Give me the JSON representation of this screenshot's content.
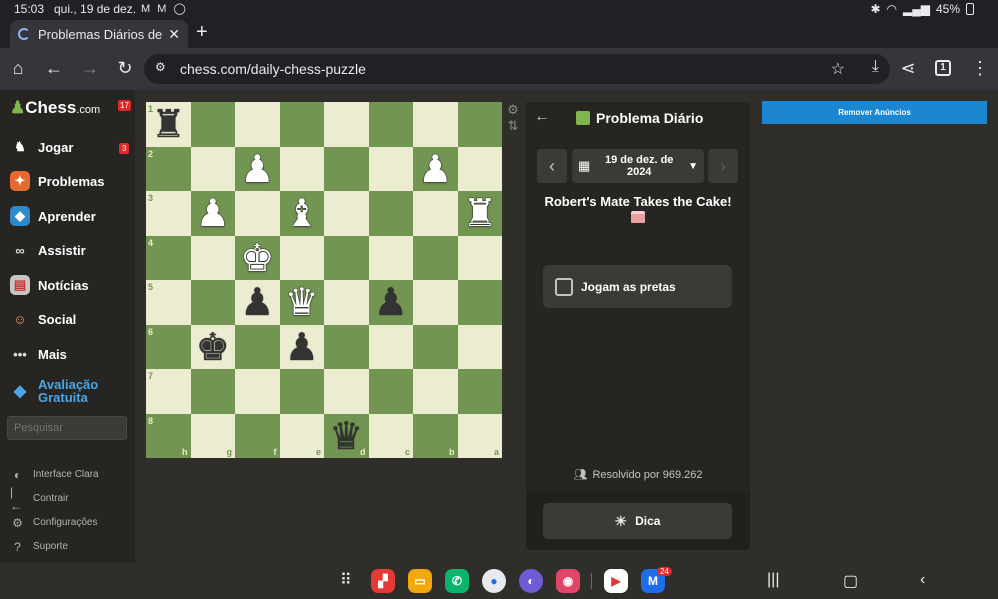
{
  "status": {
    "time": "15:03",
    "date": "qui., 19 de dez.",
    "notif_icons": "M M ◯",
    "battery": "45%"
  },
  "browser": {
    "tab_title": "Problemas Diários de Xadrez",
    "url": "chess.com/daily-chess-puzzle",
    "tab_count": "1"
  },
  "sidebar": {
    "logo": "Chess",
    "logo_suffix": ".com",
    "logo_badge": "17",
    "items": [
      {
        "label": "Jogar",
        "icon": "play-icon",
        "badge": "3"
      },
      {
        "label": "Problemas",
        "icon": "puzzle-icon"
      },
      {
        "label": "Aprender",
        "icon": "learn-icon"
      },
      {
        "label": "Assistir",
        "icon": "watch-icon"
      },
      {
        "label": "Notícias",
        "icon": "news-icon"
      },
      {
        "label": "Social",
        "icon": "social-icon"
      },
      {
        "label": "Mais",
        "icon": "more-icon"
      }
    ],
    "trial_line1": "Avaliação",
    "trial_line2": "Gratuita",
    "search_placeholder": "Pesquisar",
    "bottom": [
      {
        "label": "Interface Clara",
        "icon": "theme-icon"
      },
      {
        "label": "Contrair",
        "icon": "collapse-icon"
      },
      {
        "label": "Configurações",
        "icon": "settings-icon"
      },
      {
        "label": "Suporte",
        "icon": "help-icon"
      }
    ]
  },
  "board": {
    "ranks": [
      "1",
      "2",
      "3",
      "4",
      "5",
      "6",
      "7",
      "8"
    ],
    "files": [
      "h",
      "g",
      "f",
      "e",
      "d",
      "c",
      "b",
      "a"
    ],
    "pieces": [
      {
        "row": 0,
        "col": 0,
        "glyph": "♜",
        "color": "b"
      },
      {
        "row": 1,
        "col": 2,
        "glyph": "♟",
        "color": "w"
      },
      {
        "row": 1,
        "col": 6,
        "glyph": "♟",
        "color": "w"
      },
      {
        "row": 2,
        "col": 1,
        "glyph": "♟",
        "color": "w"
      },
      {
        "row": 2,
        "col": 3,
        "glyph": "♝",
        "color": "w"
      },
      {
        "row": 2,
        "col": 7,
        "glyph": "♜",
        "color": "w"
      },
      {
        "row": 3,
        "col": 2,
        "glyph": "♚",
        "color": "w"
      },
      {
        "row": 4,
        "col": 2,
        "glyph": "♟",
        "color": "b"
      },
      {
        "row": 4,
        "col": 3,
        "glyph": "♛",
        "color": "w"
      },
      {
        "row": 4,
        "col": 5,
        "glyph": "♟",
        "color": "b"
      },
      {
        "row": 5,
        "col": 1,
        "glyph": "♚",
        "color": "b"
      },
      {
        "row": 5,
        "col": 3,
        "glyph": "♟",
        "color": "b"
      },
      {
        "row": 7,
        "col": 4,
        "glyph": "♛",
        "color": "b"
      }
    ]
  },
  "puzzle": {
    "title": "Problema Diário",
    "date_line1": "19 de dez. de",
    "date_line2": "2024",
    "name": "Robert's Mate Takes the Cake!",
    "color_label": "Jogam as pretas",
    "solved": "Resolvido por 969.262",
    "hint": "Dica"
  },
  "ad_button": "Remover Anúncios",
  "dock": {
    "badge": "24"
  }
}
